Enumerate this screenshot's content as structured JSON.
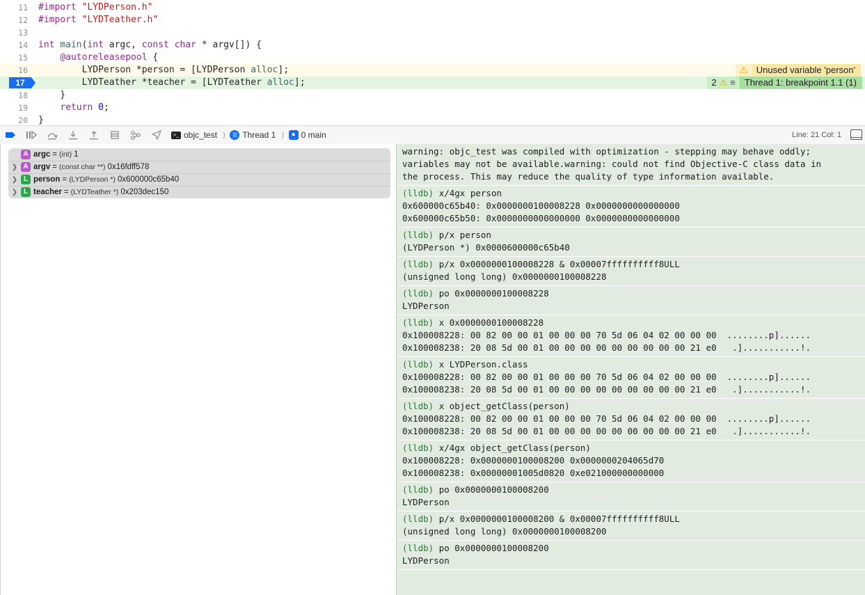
{
  "editor": {
    "lines": [
      {
        "num": "11",
        "parts": [
          {
            "t": "#import ",
            "c": "kw"
          },
          {
            "t": "\"LYDPerson.h\"",
            "c": "str"
          }
        ]
      },
      {
        "num": "12",
        "parts": [
          {
            "t": "#import ",
            "c": "kw"
          },
          {
            "t": "\"LYDTeather.h\"",
            "c": "str"
          }
        ]
      },
      {
        "num": "13",
        "parts": []
      },
      {
        "num": "14",
        "parts": [
          {
            "t": "int ",
            "c": "kw"
          },
          {
            "t": "main",
            "c": "fn"
          },
          {
            "t": "(",
            "c": ""
          },
          {
            "t": "int",
            "c": "kw"
          },
          {
            "t": " argc, ",
            "c": ""
          },
          {
            "t": "const char",
            "c": "kw"
          },
          {
            "t": " * argv[]) {",
            "c": ""
          }
        ]
      },
      {
        "num": "15",
        "parts": [
          {
            "t": "    ",
            "c": ""
          },
          {
            "t": "@autoreleasepool",
            "c": "kw"
          },
          {
            "t": " {",
            "c": ""
          }
        ]
      },
      {
        "num": "16",
        "parts": [
          {
            "t": "        LYDPerson *person = [LYDPerson ",
            "c": ""
          },
          {
            "t": "alloc",
            "c": "fn"
          },
          {
            "t": "];",
            "c": ""
          }
        ]
      },
      {
        "num": "17",
        "parts": [
          {
            "t": "        LYDTeather *teacher = [LYDTeather ",
            "c": ""
          },
          {
            "t": "alloc",
            "c": "fn"
          },
          {
            "t": "];",
            "c": ""
          }
        ]
      },
      {
        "num": "18",
        "parts": [
          {
            "t": "    }",
            "c": ""
          }
        ]
      },
      {
        "num": "19",
        "parts": [
          {
            "t": "    ",
            "c": ""
          },
          {
            "t": "return ",
            "c": "kw"
          },
          {
            "t": "0",
            "c": "num"
          },
          {
            "t": ";",
            "c": ""
          }
        ]
      },
      {
        "num": "20",
        "parts": [
          {
            "t": "}",
            "c": ""
          }
        ]
      }
    ],
    "warning_line": "16",
    "breakpoint_line": "17",
    "warning_message": "Unused variable 'person'",
    "breakpoint_count": "2",
    "breakpoint_message": "Thread 1: breakpoint 1.1 (1)"
  },
  "debug_bar": {
    "target": "objc_test",
    "thread": "Thread 1",
    "frame": "0 main",
    "line_col": "Line: 21  Col: 1"
  },
  "variables": [
    {
      "badge": "A",
      "name": "argc",
      "type": "(int)",
      "value": "1",
      "expandable": false
    },
    {
      "badge": "A",
      "name": "argv",
      "type": "(const char **)",
      "value": "0x16fdff578",
      "expandable": true
    },
    {
      "badge": "L",
      "name": "person",
      "type": "(LYDPerson *)",
      "value": "0x600000c65b40",
      "expandable": true
    },
    {
      "badge": "L",
      "name": "teacher",
      "type": "(LYDTeather *)",
      "value": "0x203dec150",
      "expandable": true
    }
  ],
  "console": [
    {
      "lines": [
        "warning: objc_test was compiled with optimization - stepping may behave oddly;",
        "variables may not be available.warning: could not find Objective-C class data in",
        "the process. This may reduce the quality of type information available."
      ]
    },
    {
      "prompt": "(lldb)",
      "cmd": "x/4gx person",
      "lines": [
        "0x600000c65b40: 0x0000000100008228 0x0000000000000000",
        "0x600000c65b50: 0x0000000000000000 0x0000000000000000"
      ]
    },
    {
      "prompt": "(lldb)",
      "cmd": "p/x person",
      "lines": [
        "(LYDPerson *) 0x0000600000c65b40"
      ]
    },
    {
      "prompt": "(lldb)",
      "cmd": "p/x 0x0000000100008228 & 0x00007ffffffffff8ULL",
      "lines": [
        "(unsigned long long) 0x0000000100008228"
      ]
    },
    {
      "prompt": "(lldb)",
      "cmd": "po 0x0000000100008228",
      "lines": [
        "LYDPerson"
      ]
    },
    {
      "prompt": "(lldb)",
      "cmd": "x 0x0000000100008228",
      "lines": [
        "0x100008228: 00 82 00 00 01 00 00 00 70 5d 06 04 02 00 00 00  ........p]......",
        "0x100008238: 20 08 5d 00 01 00 00 00 00 00 00 00 00 00 21 e0   .]...........!."
      ]
    },
    {
      "prompt": "(lldb)",
      "cmd": "x LYDPerson.class",
      "lines": [
        "0x100008228: 00 82 00 00 01 00 00 00 70 5d 06 04 02 00 00 00  ........p]......",
        "0x100008238: 20 08 5d 00 01 00 00 00 00 00 00 00 00 00 21 e0   .]...........!."
      ]
    },
    {
      "prompt": "(lldb)",
      "cmd": "x object_getClass(person)",
      "lines": [
        "0x100008228: 00 82 00 00 01 00 00 00 70 5d 06 04 02 00 00 00  ........p]......",
        "0x100008238: 20 08 5d 00 01 00 00 00 00 00 00 00 00 00 21 e0   .]...........!."
      ]
    },
    {
      "prompt": "(lldb)",
      "cmd": "x/4gx object_getClass(person)",
      "lines": [
        "0x100008228: 0x0000000100008200 0x0000000204065d70",
        "0x100008238: 0x00000001005d0820 0xe021000000000000"
      ]
    },
    {
      "prompt": "(lldb)",
      "cmd": "po 0x0000000100008200",
      "lines": [
        "LYDPerson"
      ]
    },
    {
      "prompt": "(lldb)",
      "cmd": "p/x 0x0000000100008200 & 0x00007ffffffffff8ULL",
      "lines": [
        "(unsigned long long) 0x0000000100008200"
      ]
    },
    {
      "prompt": "(lldb)",
      "cmd": "po 0x0000000100008200",
      "lines": [
        "LYDPerson"
      ]
    }
  ]
}
